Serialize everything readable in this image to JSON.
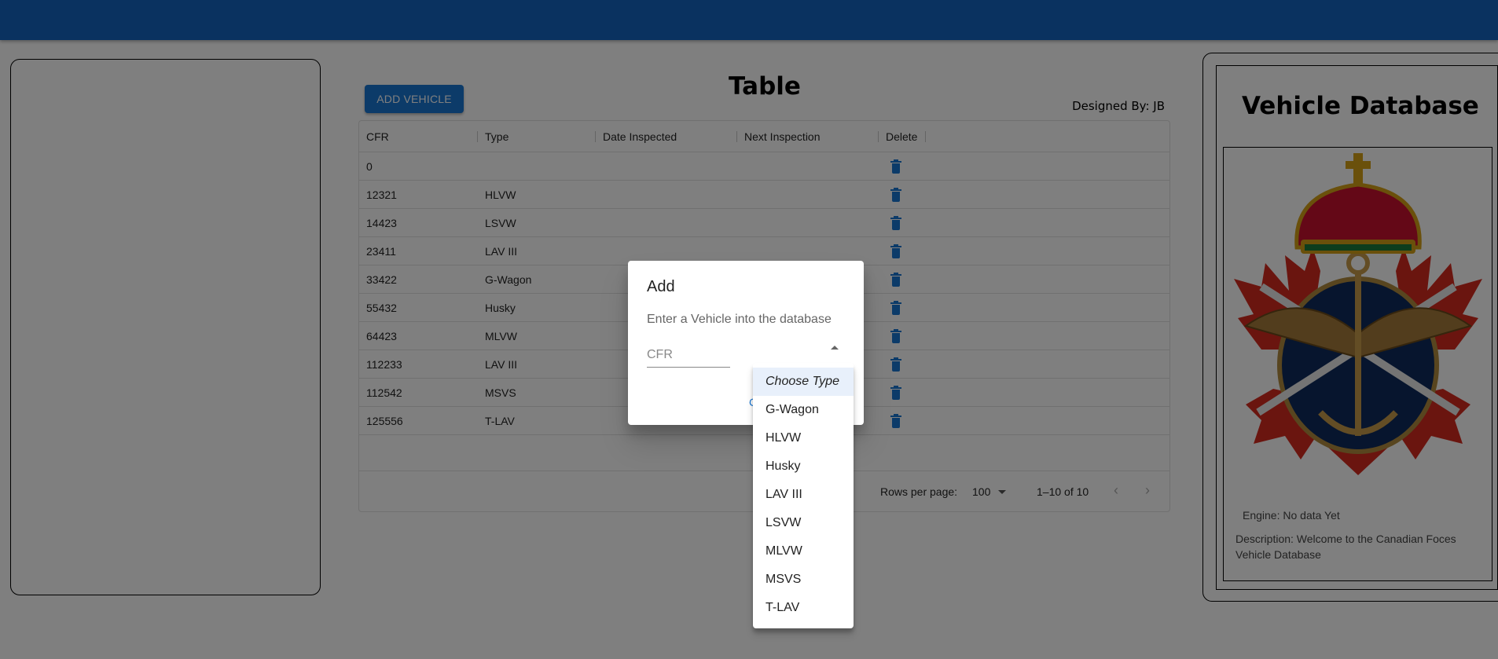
{
  "appbar": {},
  "table_section": {
    "add_button_label": "ADD VEHICLE",
    "title": "Table",
    "designed_by": "Designed By: JB",
    "columns": [
      "CFR",
      "Type",
      "Date Inspected",
      "Next Inspection",
      "Delete"
    ],
    "rows": [
      {
        "cfr": "0",
        "type": ""
      },
      {
        "cfr": "12321",
        "type": "HLVW"
      },
      {
        "cfr": "14423",
        "type": "LSVW"
      },
      {
        "cfr": "23411",
        "type": "LAV III"
      },
      {
        "cfr": "33422",
        "type": "G-Wagon"
      },
      {
        "cfr": "55432",
        "type": "Husky"
      },
      {
        "cfr": "64423",
        "type": "MLVW"
      },
      {
        "cfr": "112233",
        "type": "LAV III"
      },
      {
        "cfr": "112542",
        "type": "MSVS"
      },
      {
        "cfr": "125556",
        "type": "T-LAV"
      }
    ],
    "footer": {
      "rows_per_page_label": "Rows per page:",
      "rows_per_page_value": "100",
      "range": "1–10 of 10"
    }
  },
  "info_panel": {
    "title": "Vehicle Database",
    "engine": "Engine: No data Yet",
    "description": "Description: Welcome to the Canadian Foces Vehicle Database"
  },
  "dialog": {
    "title": "Add",
    "text": "Enter a Vehicle into the database",
    "cfr_placeholder": "CFR",
    "cfr_value": ""
  },
  "type_menu": {
    "options": [
      "Choose Type",
      "G-Wagon",
      "HLVW",
      "Husky",
      "LAV III",
      "LSVW",
      "MLVW",
      "MSVS",
      "T-LAV"
    ],
    "selected": "Choose Type"
  },
  "colors": {
    "appbar": "#1565c0",
    "primary": "#1976d2"
  }
}
